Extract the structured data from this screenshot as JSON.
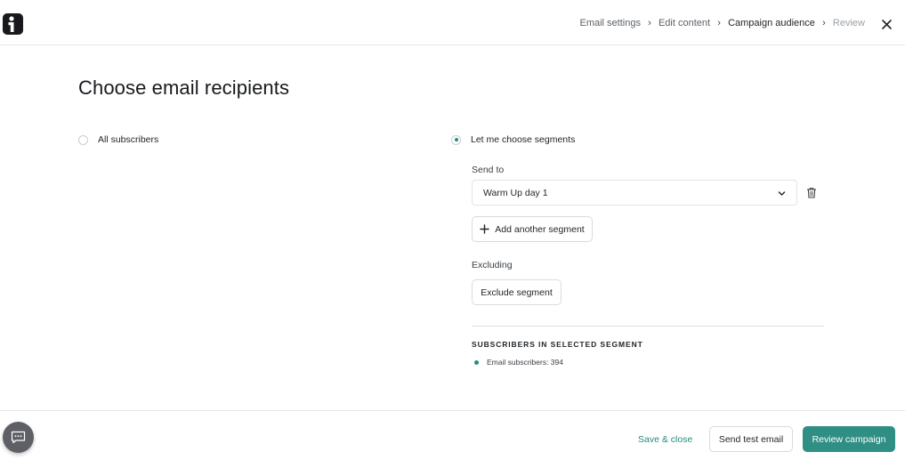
{
  "header": {
    "breadcrumbs": [
      {
        "label": "Email settings",
        "state": "done"
      },
      {
        "label": "Edit content",
        "state": "done"
      },
      {
        "label": "Campaign audience",
        "state": "active"
      },
      {
        "label": "Review",
        "state": "disabled"
      }
    ],
    "logo_icon": "brand-logo-icon",
    "close_icon": "close-icon"
  },
  "main": {
    "title": "Choose email recipients",
    "audience_options": [
      {
        "label": "All subscribers",
        "checked": false
      },
      {
        "label": "Let me choose segments",
        "checked": true
      }
    ],
    "send_to": {
      "label": "Send to",
      "selected_segment": "Warm Up day 1",
      "add_segment_label": "Add another segment"
    },
    "excluding": {
      "label": "Excluding",
      "button_label": "Exclude segment"
    },
    "summary": {
      "heading": "SUBSCRIBERS IN SELECTED SEGMENT",
      "count_text": "Email subscribers: 394"
    }
  },
  "footer": {
    "save_close_label": "Save & close",
    "send_test_label": "Send test email",
    "review_label": "Review campaign"
  },
  "colors": {
    "accent": "#2f8f84",
    "text": "#1f2328",
    "border": "#d8dbdf"
  }
}
